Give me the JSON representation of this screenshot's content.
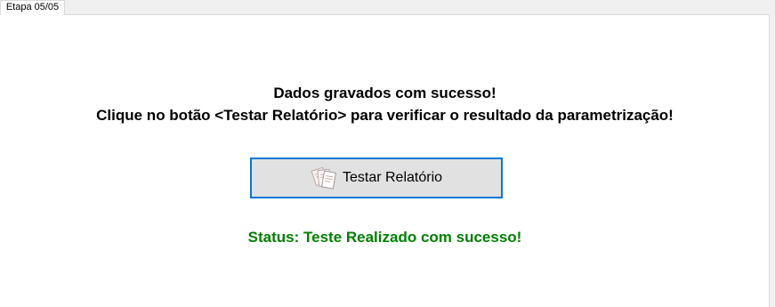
{
  "tab": {
    "label": "Etapa 05/05"
  },
  "messages": {
    "line1": "Dados gravados com sucesso!",
    "line2": "Clique no botão <Testar Relatório> para verificar o resultado da parametrização!"
  },
  "test_button": {
    "label": "Testar Relatório",
    "icon": "documents-icon"
  },
  "status": {
    "text": "Status: Teste Realizado com sucesso!",
    "color": "#008000"
  },
  "colors": {
    "button_border": "#0078d7",
    "button_face": "#e1e1e1",
    "panel_background": "#ffffff",
    "window_background": "#f0f0f0"
  }
}
